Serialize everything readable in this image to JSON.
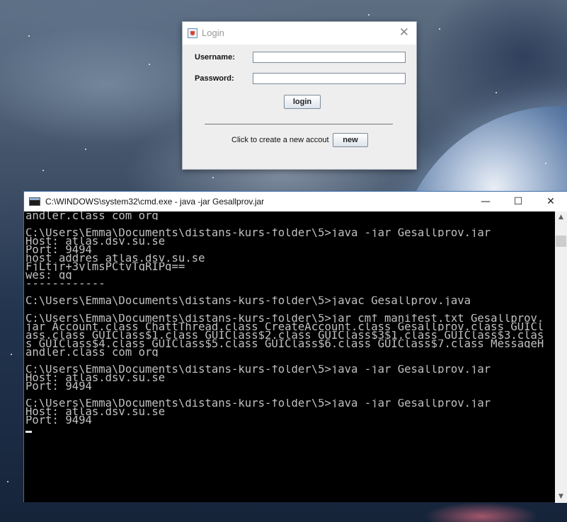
{
  "login_window": {
    "title": "Login",
    "close_glyph": "✕",
    "username_label": "Username:",
    "username_value": "",
    "password_label": "Password:",
    "password_value": "",
    "login_button": "login",
    "create_account_label": "Click to create a new accout",
    "new_button": "new"
  },
  "cmd_window": {
    "title": "C:\\WINDOWS\\system32\\cmd.exe - java  -jar Gesallprov.jar",
    "minimize_glyph": "—",
    "maximize_glyph": "☐",
    "close_glyph": "✕",
    "lines": [
      "andler.class com org",
      "",
      "C:\\Users\\Emma\\Documents\\distans-kurs-folder\\5>java -jar Gesallprov.jar",
      "Host: atlas.dsv.su.se",
      "Port: 9494",
      "host addres atlas.dsv.su.se",
      "FjLtjr+3ylmsPCtvTqRIPg==",
      "wes: gg",
      "------------",
      "",
      "C:\\Users\\Emma\\Documents\\distans-kurs-folder\\5>javac Gesallprov.java",
      "",
      "C:\\Users\\Emma\\Documents\\distans-kurs-folder\\5>jar cmf manifest.txt Gesallprov.",
      "jar Account.class ChattThread.class CreateAccount.class Gesallprov.class GUICl",
      "ass.class GUIClass$1.class GUIClass$2.class GUIClass$3$1.class GUIClass$3.clas",
      "s GUIClass$4.class GUIClass$5.class GUIClass$6.class GUIClass$7.class MessageH",
      "andler.class com org",
      "",
      "C:\\Users\\Emma\\Documents\\distans-kurs-folder\\5>java -jar Gesallprov.jar",
      "Host: atlas.dsv.su.se",
      "Port: 9494",
      "",
      "C:\\Users\\Emma\\Documents\\distans-kurs-folder\\5>java -jar Gesallprov.jar",
      "Host: atlas.dsv.su.se",
      "Port: 9494",
      ""
    ],
    "scroll_up_glyph": "▲",
    "scroll_down_glyph": "▼"
  },
  "colors": {
    "console_background": "#000000",
    "console_text": "#c0c0c0",
    "dialog_background": "#eeeeee"
  }
}
